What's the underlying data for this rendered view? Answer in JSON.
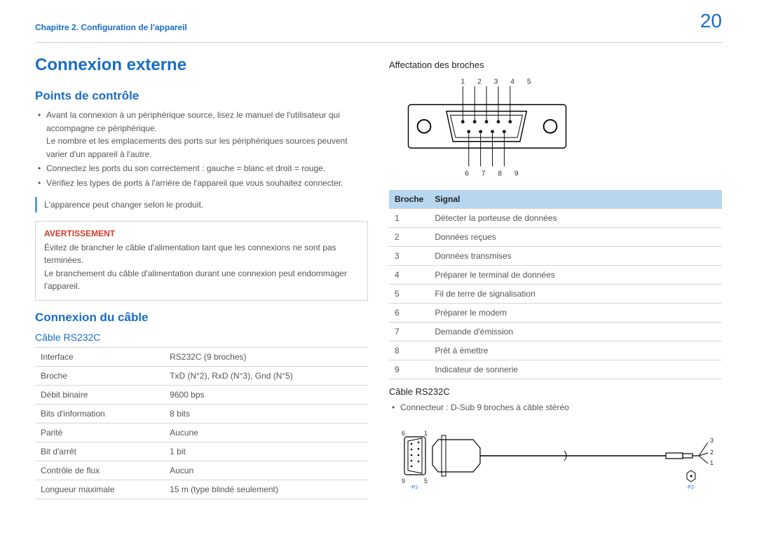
{
  "header": {
    "chapter": "Chapitre 2. Configuration de l'appareil",
    "page_number": "20"
  },
  "left": {
    "main_heading": "Connexion externe",
    "section_checkpoints": "Points de contrôle",
    "bullets": [
      "Avant la connexion à un périphérique source, lisez le manuel de l'utilisateur qui accompagne ce périphérique.\nLe nombre et les emplacements des ports sur les périphériques sources peuvent varier d'un appareil à l'autre.",
      "Connectez les ports du son correctement : gauche = blanc et droit = rouge.",
      "Vérifiez les types de ports à l'arrière de l'appareil que vous souhaitez connecter."
    ],
    "note": "L'apparence peut changer selon le produit.",
    "warning": {
      "heading": "AVERTISSEMENT",
      "body": "Évitez de brancher le câble d'alimentation tant que les connexions ne sont pas terminées.\nLe branchement du câble d'alimentation durant une connexion peut endommager l'appareil."
    },
    "section_cable": "Connexion du câble",
    "sub_cable": "Câble RS232C",
    "spec_table": [
      [
        "Interface",
        "RS232C (9 broches)"
      ],
      [
        "Broche",
        "TxD (N°2), RxD (N°3), Gnd (N°5)"
      ],
      [
        "Débit binaire",
        "9600 bps"
      ],
      [
        "Bits d'information",
        "8 bits"
      ],
      [
        "Parité",
        "Aucune"
      ],
      [
        "Bit d'arrêt",
        "1 bit"
      ],
      [
        "Contrôle de flux",
        "Aucun"
      ],
      [
        "Longueur maximale",
        "15 m (type blindé seulement)"
      ]
    ]
  },
  "right": {
    "heading_pins": "Affectation des broches",
    "pinlabels_top": "1 2 3 4 5",
    "pinlabels_bottom": "6 7 8 9",
    "pin_table_head": [
      "Broche",
      "Signal"
    ],
    "pin_table": [
      [
        "1",
        "Détecter la porteuse de données"
      ],
      [
        "2",
        "Données reçues"
      ],
      [
        "3",
        "Données transmises"
      ],
      [
        "4",
        "Préparer le terminal de données"
      ],
      [
        "5",
        "Fil de terre de signalisation"
      ],
      [
        "6",
        "Préparer le modem"
      ],
      [
        "7",
        "Demande d'émission"
      ],
      [
        "8",
        "Prêt à émettre"
      ],
      [
        "9",
        "Indicateur de sonnerie"
      ]
    ],
    "sub_cable2": "Câble RS232C",
    "connector_bullet": "Connecteur : D-Sub 9 broches à câble stéréo",
    "cable_diag": {
      "left_top": "6",
      "left_right": "1",
      "left_bottom": "9",
      "left_bottom_right": "5",
      "p1": "-P1-",
      "p2": "-P2-",
      "right_nums": [
        "3",
        "2",
        "1"
      ]
    }
  }
}
